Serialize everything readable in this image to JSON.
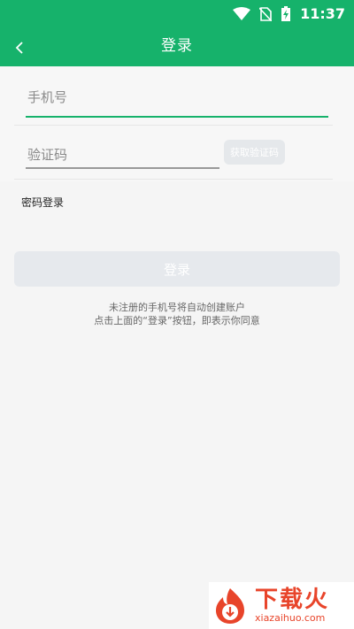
{
  "statusbar": {
    "time": "11:37",
    "icons": [
      "wifi-icon",
      "no-sim-icon",
      "battery-charging-icon"
    ]
  },
  "appbar": {
    "title": "登录",
    "back_icon": "chevron-left-icon"
  },
  "form": {
    "phone_placeholder": "手机号",
    "code_placeholder": "验证码",
    "get_code_label": "获取验证码",
    "password_login_label": "密码登录"
  },
  "login": {
    "button_label": "登录"
  },
  "tips": {
    "line1": "未注册的手机号将自动创建账户",
    "line2": "点击上面的“登录”按钮，即表示你同意"
  },
  "watermark": {
    "cn": "下载火",
    "en": "xiazaihuo.com"
  },
  "colors": {
    "primary": "#16b26b",
    "disabled": "#e6e9ed",
    "watermark": "#e8442a"
  }
}
